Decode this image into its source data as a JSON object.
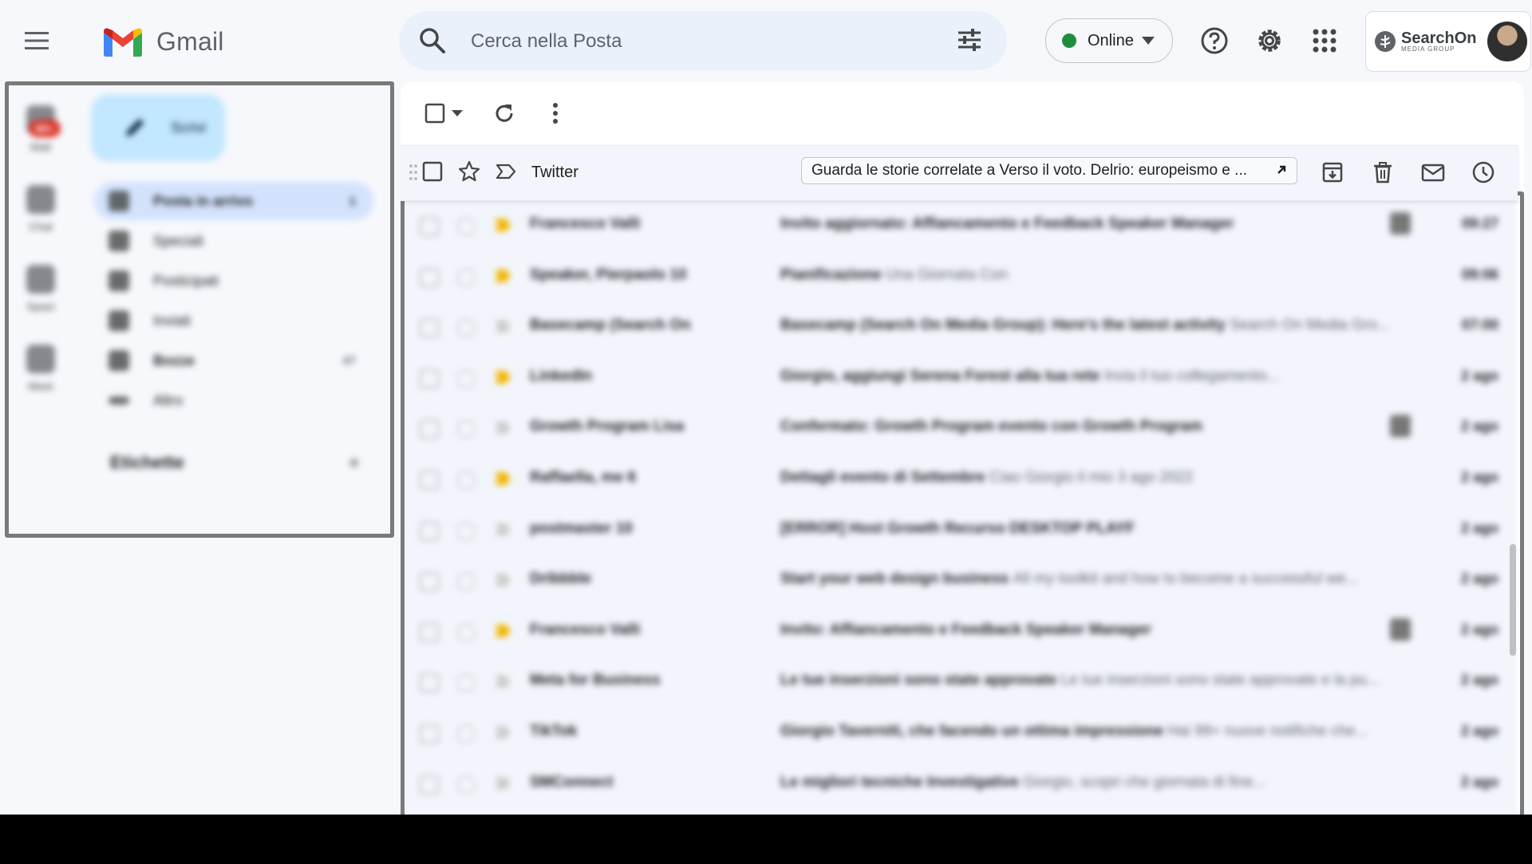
{
  "header": {
    "app_name": "Gmail",
    "search_placeholder": "Cerca nella Posta",
    "status_label": "Online",
    "status_color": "#1e8e3e",
    "brand_name": "SearchOn",
    "brand_sub": "MEDIA GROUP",
    "icons": [
      "menu-icon",
      "search-icon",
      "filter-icon",
      "help-icon",
      "settings-icon",
      "apps-icon"
    ]
  },
  "rail": {
    "badge": "99+",
    "items": [
      {
        "label": "Mail",
        "icon": "mail-icon"
      },
      {
        "label": "Chat",
        "icon": "chat-icon"
      },
      {
        "label": "Spazi",
        "icon": "spaces-icon"
      },
      {
        "label": "Meet",
        "icon": "meet-icon"
      }
    ]
  },
  "sidebar": {
    "compose_label": "Scrivi",
    "items": [
      {
        "label": "Posta in arrivo",
        "count": "1",
        "icon": "inbox-icon"
      },
      {
        "label": "Speciali",
        "count": "",
        "icon": "star-icon"
      },
      {
        "label": "Posticipati",
        "count": "",
        "icon": "clock-icon"
      },
      {
        "label": "Inviati",
        "count": "",
        "icon": "send-icon"
      },
      {
        "label": "Bozze",
        "count": "47",
        "icon": "draft-icon"
      },
      {
        "label": "Altro",
        "count": "",
        "icon": "chevron-down-icon"
      }
    ],
    "labels_heading": "Etichette",
    "labels_add": "+"
  },
  "hover_row": {
    "sender": "Twitter",
    "chip_text": "Guarda le storie correlate a Verso il voto. Delrio: europeismo e ..."
  },
  "emails": [
    {
      "sender": "Francesco Valli",
      "subject": "Invito aggiornato: Affiancamento e Feedback Speaker Manager",
      "snippet": "",
      "date": "09:27",
      "important": true,
      "calendar": true
    },
    {
      "sender": "Speaker, Pierpaolo 10",
      "subject": "Pianificazione",
      "snippet": "Una Giornata Con",
      "date": "09:06",
      "important": true,
      "calendar": false
    },
    {
      "sender": "Basecamp (Search On",
      "subject": "Basecamp (Search On Media Group): Here's the latest activity",
      "snippet": "Search On Media Gro...",
      "date": "07:00",
      "important": false,
      "calendar": false
    },
    {
      "sender": "LinkedIn",
      "subject": "Giorgio, aggiungi Serena Forest alla tua rete",
      "snippet": "Invia il tuo collegamento...",
      "date": "2 ago",
      "important": true,
      "calendar": false
    },
    {
      "sender": "Growth Program Lisa",
      "subject": "Confermato: Growth Program evento con Growth Program",
      "snippet": "",
      "date": "2 ago",
      "important": false,
      "calendar": true
    },
    {
      "sender": "Raffaella, me 6",
      "subject": "Dettagli evento di Settembre",
      "snippet": "Ciao Giorgio il mio 3 ago 2022",
      "date": "2 ago",
      "important": true,
      "calendar": false
    },
    {
      "sender": "postmaster 10",
      "subject": "[ERROR] Host Growth Recurso DESKTOP PLAYF",
      "snippet": "",
      "date": "2 ago",
      "important": false,
      "calendar": false
    },
    {
      "sender": "Dribbble",
      "subject": "Start your web design business",
      "snippet": "All my toolkit and how to become a successful we...",
      "date": "2 ago",
      "important": false,
      "calendar": false
    },
    {
      "sender": "Francesco Valli",
      "subject": "Invito: Affiancamento e Feedback Speaker Manager",
      "snippet": "",
      "date": "2 ago",
      "important": true,
      "calendar": true
    },
    {
      "sender": "Meta for Business",
      "subject": "Le tue inserzioni sono state approvate",
      "snippet": "Le tue inserzioni sono state approvate e la pu...",
      "date": "2 ago",
      "important": false,
      "calendar": false
    },
    {
      "sender": "TikTok",
      "subject": "Giorgio Taverniti, che facendo un ottima impressione",
      "snippet": "Hai 99+ nuove notifiche che...",
      "date": "2 ago",
      "important": false,
      "calendar": false
    },
    {
      "sender": "SMConnect",
      "subject": "Le migliori tecniche Investigative",
      "snippet": "Giorgio, scopri che giornata di fine...",
      "date": "2 ago",
      "important": false,
      "calendar": false
    },
    {
      "sender": "",
      "subject": "",
      "snippet": "",
      "date": "",
      "important": false,
      "calendar": false
    }
  ]
}
